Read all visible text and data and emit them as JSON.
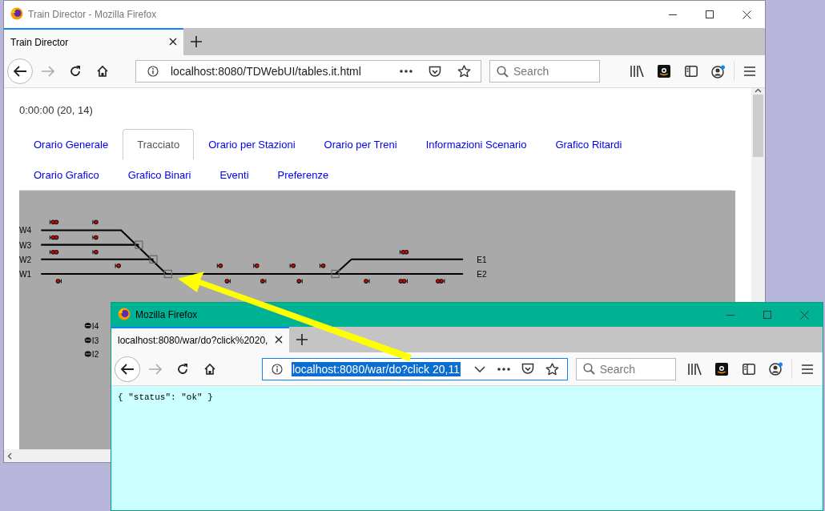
{
  "desktop": {
    "windows": [
      {
        "kind": "train-director",
        "active": false,
        "title": "Train Director - Mozilla Firefox",
        "tabs": [
          {
            "label": "Train Director",
            "selected": true
          }
        ],
        "address": {
          "value": "localhost:8080/TDWebUI/tables.it.html",
          "selected": false,
          "dropdown": false
        },
        "search": {
          "placeholder": "Search"
        },
        "page": {
          "clock": "0:00:00 (20, 14)",
          "tabs": [
            {
              "label": "Orario Generale",
              "selected": false
            },
            {
              "label": "Tracciato",
              "selected": true
            },
            {
              "label": "Orario per Stazioni",
              "selected": false
            },
            {
              "label": "Orario per Treni",
              "selected": false
            },
            {
              "label": "Informazioni Scenario",
              "selected": false
            },
            {
              "label": "Grafico Ritardi",
              "selected": false
            },
            {
              "label": "Orario Grafico",
              "selected": false
            },
            {
              "label": "Grafico Binari",
              "selected": false
            },
            {
              "label": "Eventi",
              "selected": false
            },
            {
              "label": "Preferenze",
              "selected": false
            }
          ],
          "layout": {
            "west_labels": [
              "W4",
              "W3",
              "W2",
              "W1"
            ],
            "east_labels": [
              "E1",
              "E2"
            ],
            "itineraries": [
              "I4",
              "I3",
              "I2"
            ]
          }
        }
      },
      {
        "kind": "json-response",
        "active": true,
        "title": "Mozilla Firefox",
        "tabs": [
          {
            "label": "localhost:8080/war/do?click%2020,",
            "selected": true
          }
        ],
        "address": {
          "value": "localhost:8080/war/do?click 20,11",
          "selected": true,
          "dropdown": true
        },
        "search": {
          "placeholder": "Search"
        },
        "document_text": "{ \"status\": \"ok\" }"
      }
    ]
  }
}
